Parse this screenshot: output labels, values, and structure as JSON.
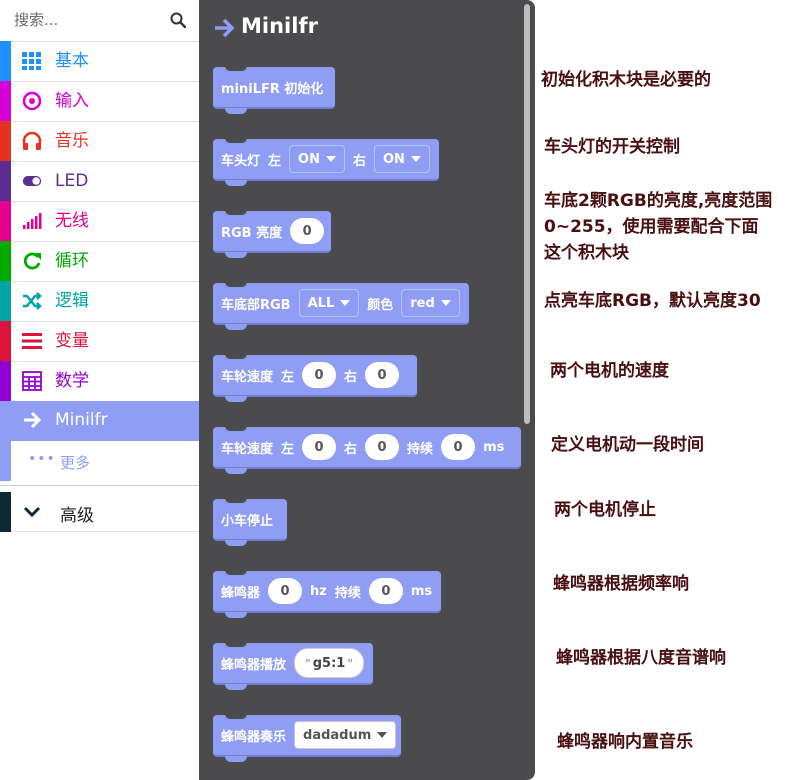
{
  "search": {
    "placeholder": "搜索...",
    "icon": "search-icon"
  },
  "categories": [
    {
      "label": "基本",
      "color": "#1e90ff",
      "icon": "grid-icon"
    },
    {
      "label": "输入",
      "color": "#d400d4",
      "icon": "target-icon"
    },
    {
      "label": "音乐",
      "color": "#e63022",
      "icon": "headphones-icon"
    },
    {
      "label": "LED",
      "color": "#5c2d91",
      "icon": "toggle-icon"
    },
    {
      "label": "无线",
      "color": "#e3008c",
      "icon": "signal-icon"
    },
    {
      "label": "循环",
      "color": "#00aa00",
      "icon": "refresh-icon"
    },
    {
      "label": "逻辑",
      "color": "#00a4a6",
      "icon": "shuffle-icon"
    },
    {
      "label": "变量",
      "color": "#dc143c",
      "icon": "list-icon"
    },
    {
      "label": "数学",
      "color": "#9400d3",
      "icon": "calculator-icon"
    },
    {
      "label": "Minilfr",
      "color": "#8f9ef4",
      "icon": "arrow-right-icon"
    }
  ],
  "more": {
    "label": "更多",
    "icon": "dots-icon"
  },
  "advanced": {
    "label": "高级",
    "color": "#0f2a34",
    "icon": "chevron-down-icon"
  },
  "flyout": {
    "title": "Minilfr",
    "blocks": {
      "init": {
        "label": "miniLFR 初始化"
      },
      "headlight": {
        "label": "车头灯",
        "left": "左",
        "left_value": "ON",
        "right": "右",
        "right_value": "ON"
      },
      "rgb_brightness": {
        "label": "RGB 亮度",
        "value": "0"
      },
      "bottom_rgb": {
        "label": "车底部RGB",
        "target": "ALL",
        "color_label": "颜色",
        "color_value": "red"
      },
      "wheel_speed": {
        "label": "车轮速度",
        "left": "左",
        "left_value": "0",
        "right": "右",
        "right_value": "0"
      },
      "wheel_speed_timed": {
        "label": "车轮速度",
        "left": "左",
        "left_value": "0",
        "right": "右",
        "right_value": "0",
        "duration": "持续",
        "duration_value": "0",
        "unit": "ms"
      },
      "stop": {
        "label": "小车停止"
      },
      "buzzer": {
        "label": "蜂鸣器",
        "hz_value": "0",
        "hz": "hz",
        "duration": "持续",
        "duration_value": "0",
        "unit": "ms"
      },
      "buzzer_play": {
        "label": "蜂鸣器播放",
        "note": "g5:1"
      },
      "buzzer_music": {
        "label": "蜂鸣器奏乐",
        "melody": "dadadum"
      }
    }
  },
  "notes": [
    "初始化积木块是必要的",
    "车头灯的开关控制",
    "车底2颗RGB的亮度,亮度范围",
    "0~255，使用需要配合下面",
    "这个积木块",
    "点亮车底RGB，默认亮度30",
    "两个电机的速度",
    "定义电机动一段时间",
    "两个电机停止",
    "蜂鸣器根据频率响",
    "蜂鸣器根据八度音谱响",
    "蜂鸣器响内置音乐"
  ]
}
